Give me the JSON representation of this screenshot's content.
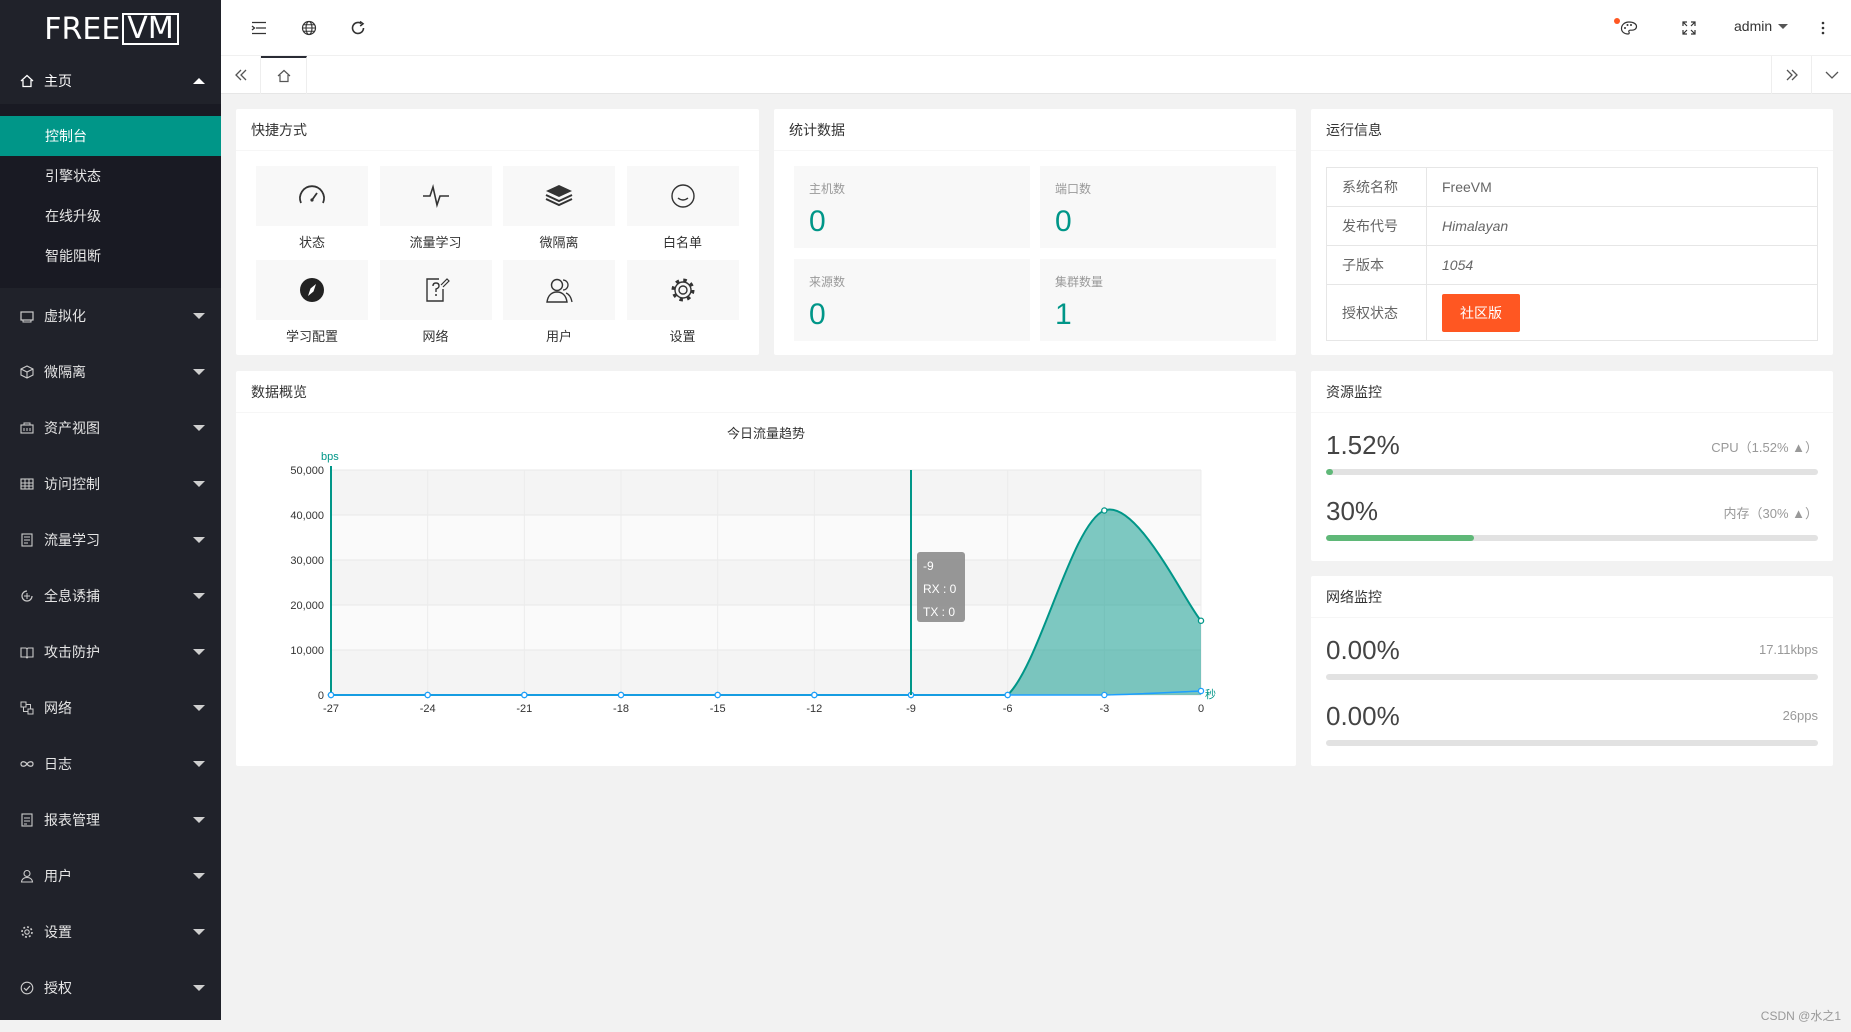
{
  "logo": {
    "part1": "FREE",
    "part2": "VM"
  },
  "sidebar": {
    "home": {
      "label": "主页",
      "icon": "home-icon"
    },
    "home_sub": [
      {
        "label": "控制台",
        "active": true
      },
      {
        "label": "引擎状态"
      },
      {
        "label": "在线升级"
      },
      {
        "label": "智能阻断"
      }
    ],
    "items": [
      {
        "label": "虚拟化",
        "icon": "virtual-icon"
      },
      {
        "label": "微隔离",
        "icon": "cube-icon"
      },
      {
        "label": "资产视图",
        "icon": "assets-icon"
      },
      {
        "label": "访问控制",
        "icon": "grid-icon"
      },
      {
        "label": "流量学习",
        "icon": "learn-icon"
      },
      {
        "label": "全息诱捕",
        "icon": "trap-icon"
      },
      {
        "label": "攻击防护",
        "icon": "shield-book-icon"
      },
      {
        "label": "网络",
        "icon": "network-icon"
      },
      {
        "label": "日志",
        "icon": "infinity-icon"
      },
      {
        "label": "报表管理",
        "icon": "report-icon"
      },
      {
        "label": "用户",
        "icon": "user-icon"
      },
      {
        "label": "设置",
        "icon": "gear-icon"
      },
      {
        "label": "授权",
        "icon": "check-circle-icon"
      }
    ]
  },
  "header": {
    "user": "admin"
  },
  "shortcuts": {
    "title": "快捷方式",
    "items": [
      {
        "label": "状态",
        "icon": "gauge-icon"
      },
      {
        "label": "流量学习",
        "icon": "pulse-icon"
      },
      {
        "label": "微隔离",
        "icon": "layers-icon"
      },
      {
        "label": "白名单",
        "icon": "smile-icon"
      },
      {
        "label": "学习配置",
        "icon": "compass-icon"
      },
      {
        "label": "网络",
        "icon": "edit-question-icon"
      },
      {
        "label": "用户",
        "icon": "users-icon"
      },
      {
        "label": "设置",
        "icon": "gear-icon"
      }
    ]
  },
  "stats": {
    "title": "统计数据",
    "items": [
      {
        "label": "主机数",
        "value": "0"
      },
      {
        "label": "端口数",
        "value": "0"
      },
      {
        "label": "来源数",
        "value": "0"
      },
      {
        "label": "集群数量",
        "value": "1"
      }
    ]
  },
  "runinfo": {
    "title": "运行信息",
    "rows": [
      {
        "key": "系统名称",
        "value": "FreeVM"
      },
      {
        "key": "发布代号",
        "value": "Himalayan"
      },
      {
        "key": "子版本",
        "value": "1054"
      },
      {
        "key": "授权状态",
        "value": "社区版"
      }
    ]
  },
  "overview": {
    "title": "数据概览"
  },
  "chart_data": {
    "type": "area",
    "title": "今日流量趋势",
    "ylabel": "bps",
    "xlabel": "秒",
    "x": [
      -27,
      -24,
      -21,
      -18,
      -15,
      -12,
      -9,
      -6,
      -3,
      0
    ],
    "ylim": [
      0,
      50000
    ],
    "yticks": [
      "50,000",
      "40,000",
      "30,000",
      "20,000",
      "10,000",
      "0"
    ],
    "series": [
      {
        "name": "RX",
        "values": [
          0,
          0,
          0,
          0,
          0,
          0,
          0,
          0,
          41000,
          16500
        ],
        "color": "#009688"
      },
      {
        "name": "TX",
        "values": [
          0,
          0,
          0,
          0,
          0,
          0,
          0,
          0,
          0,
          900
        ],
        "color": "#1e9fff"
      }
    ],
    "tooltip": {
      "x": "-9",
      "lines": [
        "RX : 0",
        "TX : 0"
      ]
    }
  },
  "resource": {
    "title": "资源监控",
    "items": [
      {
        "value": "1.52%",
        "label": "CPU（1.52% ▲）",
        "fill": 0.0152
      },
      {
        "value": "30%",
        "label": "内存（30% ▲）",
        "fill": 0.3
      }
    ]
  },
  "network": {
    "title": "网络监控",
    "items": [
      {
        "value": "0.00%",
        "label": "17.11kbps",
        "fill": 0
      },
      {
        "value": "0.00%",
        "label": "26pps",
        "fill": 0
      }
    ]
  },
  "watermark": "CSDN @水之1"
}
